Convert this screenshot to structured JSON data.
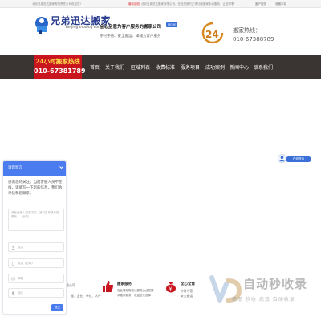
{
  "topbar": {
    "welcome": "北京兄弟迅达搬家有限责任公司欢迎您!",
    "notice_label": "最新通知：",
    "notice": "北京兄弟迅达搬家有限公司，在此您就只正得功致搬家手续服务，让您尽享一站式搬家服务！",
    "link_service": "客户服务",
    "link_favorite": "收藏本站"
  },
  "header": {
    "logo_cn": "兄弟迅达搬家",
    "logo_en": "Beijing moving company",
    "slogan": "全心全意为客户服务的搬家公司",
    "slogan_badge": "MORE",
    "subslogan": "守时守德、安全搬运、竭诚为客户服务",
    "badge_text": "24",
    "hotline_label": "搬家热线：",
    "hotline_number": "010-67388789"
  },
  "nav": {
    "hot_line1": "24小时搬家热线",
    "hot_line2": "010-67381789",
    "items": [
      "首页",
      "关于我们",
      "区域列表",
      "收费标准",
      "服务项目",
      "成功案例",
      "新闻中心",
      "联系我们"
    ]
  },
  "float_consult": {
    "label": "在线咨询"
  },
  "chat": {
    "title": "请您留言",
    "message": "感谢您的关注，当前客服人员不在线，请填写一下您的信息，我们会尽快和您联系。",
    "textarea_placeholder": "请在此输入留言内容，我们会尽快与您联系。（必填）",
    "fields": [
      {
        "placeholder": "姓名",
        "icon": "user-icon"
      },
      {
        "placeholder": "电话（必填）",
        "icon": "phone-icon"
      },
      {
        "placeholder": "邮箱",
        "icon": "mail-icon"
      },
      {
        "placeholder": "地址",
        "icon": "location-icon"
      }
    ],
    "send": "提交"
  },
  "bottom": {
    "col1_line1": "北京兄弟迅达搬家有限公司",
    "col1_line2": "搬、企业、单位、大件",
    "col2_title": "搬家服务",
    "col2_line1": "在此竭尽所能以服务企业发展",
    "col2_line2": "承搬家服务，欢迎您来选择",
    "col3_title": "全心全意",
    "col3_line1": "守时守德",
    "col3_line2": "安全搬运"
  },
  "watermark": {
    "main": "自动秒收录",
    "sub": "精品·秒收·高效·自动收录"
  },
  "colors": {
    "brand_red": "#c9151e",
    "nav_bg": "#3a3432",
    "chat_blue": "#4a7cf0",
    "logo_blue": "#2a3d8f"
  }
}
